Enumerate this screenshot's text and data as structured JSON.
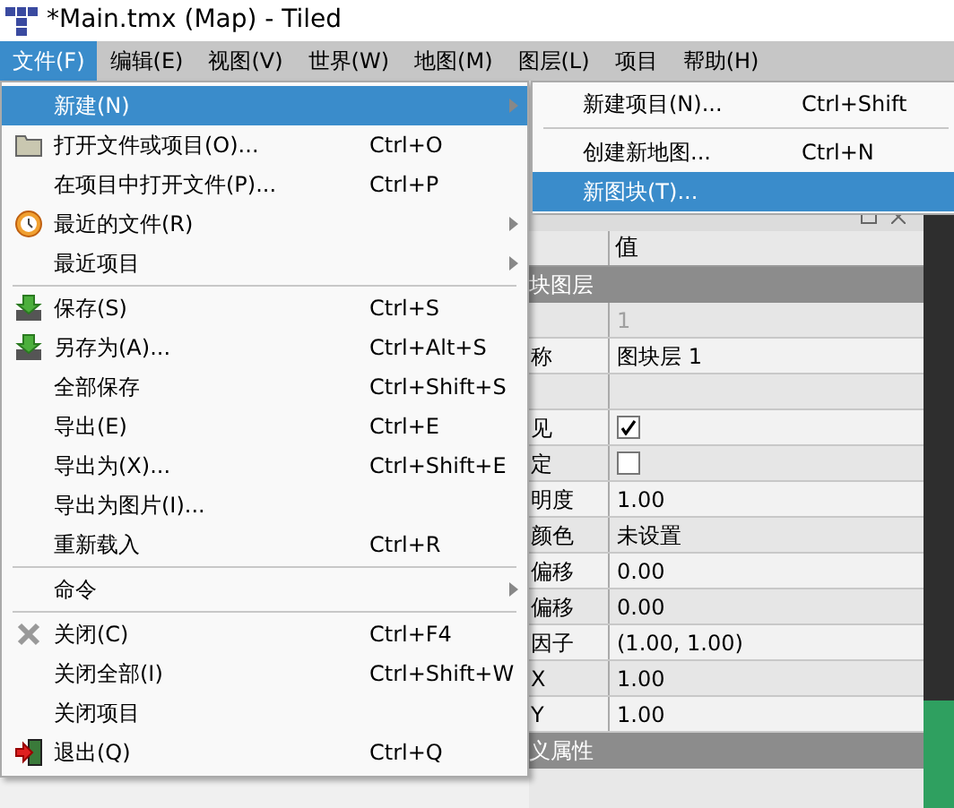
{
  "window": {
    "title": "*Main.tmx (Map) - Tiled"
  },
  "menubar": [
    {
      "label": "文件(F)",
      "selected": true
    },
    {
      "label": "编辑(E)",
      "selected": false
    },
    {
      "label": "视图(V)",
      "selected": false
    },
    {
      "label": "世界(W)",
      "selected": false
    },
    {
      "label": "地图(M)",
      "selected": false
    },
    {
      "label": "图层(L)",
      "selected": false
    },
    {
      "label": "项目",
      "selected": false
    },
    {
      "label": "帮助(H)",
      "selected": false
    }
  ],
  "file_menu": [
    {
      "kind": "item",
      "label": "新建(N)",
      "submenu": true,
      "selected": true
    },
    {
      "kind": "item",
      "label": "打开文件或项目(O)...",
      "shortcut": "Ctrl+O",
      "submenu": false,
      "selected": false
    },
    {
      "kind": "item",
      "label": "在项目中打开文件(P)...",
      "shortcut": "Ctrl+P",
      "submenu": false,
      "selected": false
    },
    {
      "kind": "item",
      "label": "最近的文件(R)",
      "submenu": true,
      "selected": false
    },
    {
      "kind": "item",
      "label": "最近项目",
      "submenu": true,
      "selected": false
    },
    {
      "kind": "separator"
    },
    {
      "kind": "item",
      "label": "保存(S)",
      "shortcut": "Ctrl+S",
      "submenu": false,
      "selected": false
    },
    {
      "kind": "item",
      "label": "另存为(A)...",
      "shortcut": "Ctrl+Alt+S",
      "submenu": false,
      "selected": false
    },
    {
      "kind": "item",
      "label": "全部保存",
      "shortcut": "Ctrl+Shift+S",
      "submenu": false,
      "selected": false
    },
    {
      "kind": "item",
      "label": "导出(E)",
      "shortcut": "Ctrl+E",
      "submenu": false,
      "selected": false
    },
    {
      "kind": "item",
      "label": "导出为(X)...",
      "shortcut": "Ctrl+Shift+E",
      "submenu": false,
      "selected": false
    },
    {
      "kind": "item",
      "label": "导出为图片(I)...",
      "submenu": false,
      "selected": false
    },
    {
      "kind": "item",
      "label": "重新载入",
      "shortcut": "Ctrl+R",
      "submenu": false,
      "selected": false
    },
    {
      "kind": "separator"
    },
    {
      "kind": "item",
      "label": "命令",
      "submenu": true,
      "selected": false
    },
    {
      "kind": "separator"
    },
    {
      "kind": "item",
      "label": "关闭(C)",
      "shortcut": "Ctrl+F4",
      "submenu": false,
      "selected": false
    },
    {
      "kind": "item",
      "label": "关闭全部(I)",
      "shortcut": "Ctrl+Shift+W",
      "submenu": false,
      "selected": false
    },
    {
      "kind": "item",
      "label": "关闭项目",
      "submenu": false,
      "selected": false
    },
    {
      "kind": "item",
      "label": "退出(Q)",
      "shortcut": "Ctrl+Q",
      "submenu": false,
      "selected": false
    }
  ],
  "new_submenu": [
    {
      "kind": "item",
      "label": "新建项目(N)...",
      "shortcut": "Ctrl+Shift",
      "selected": false
    },
    {
      "kind": "separator"
    },
    {
      "kind": "item",
      "label": "创建新地图...",
      "shortcut": "Ctrl+N",
      "selected": false
    },
    {
      "kind": "item",
      "label": "新图块(T)...",
      "selected": true
    }
  ],
  "properties": {
    "value_header": "值",
    "rows": [
      {
        "kind": "group",
        "key": "块图层"
      },
      {
        "kind": "text",
        "key": "",
        "value": "1",
        "disabled": true
      },
      {
        "kind": "text",
        "key": "称",
        "value": "图块层 1",
        "disabled": false
      },
      {
        "kind": "text",
        "key": "",
        "value": ""
      },
      {
        "kind": "checkbox",
        "key": "见",
        "checked": true
      },
      {
        "kind": "checkbox",
        "key": "定",
        "checked": false
      },
      {
        "kind": "text",
        "key": "明度",
        "value": "1.00",
        "disabled": false
      },
      {
        "kind": "text",
        "key": "颜色",
        "value": "未设置",
        "disabled": false
      },
      {
        "kind": "text",
        "key": "偏移",
        "value": "0.00",
        "disabled": false
      },
      {
        "kind": "text",
        "key": "偏移",
        "value": "0.00",
        "disabled": false
      },
      {
        "kind": "text",
        "key": "因子",
        "value": "(1.00, 1.00)",
        "disabled": false
      },
      {
        "kind": "text",
        "key": "X",
        "value": "1.00",
        "disabled": false
      },
      {
        "kind": "text",
        "key": "Y",
        "value": "1.00",
        "disabled": false
      },
      {
        "kind": "group",
        "key": "义属性"
      }
    ]
  }
}
